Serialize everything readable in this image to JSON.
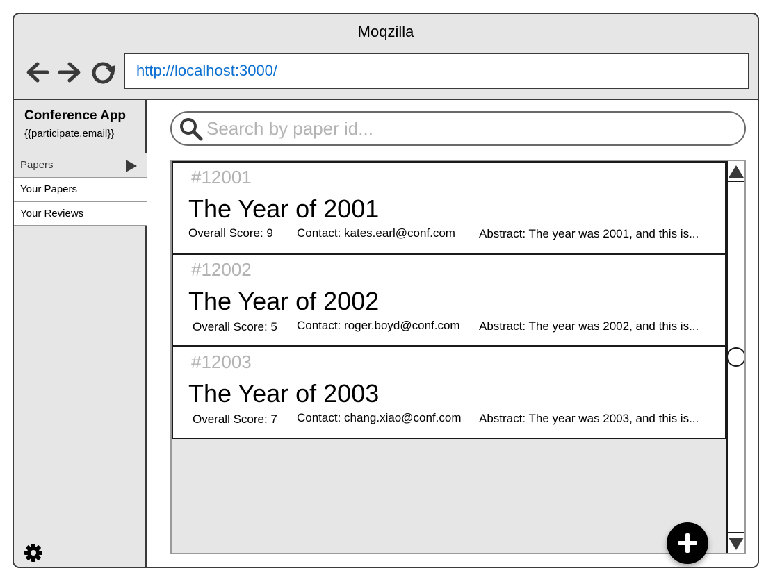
{
  "window": {
    "title": "Moqzilla"
  },
  "navbar": {
    "back_icon": "arrow-left-icon",
    "forward_icon": "arrow-right-icon",
    "reload_icon": "reload-icon",
    "url": "http://localhost:3000/"
  },
  "sidebar": {
    "app_title": "Conference App",
    "app_subtitle": "{{participate.email}}",
    "menu_header": "Papers",
    "items": [
      {
        "label": "Your Papers"
      },
      {
        "label": "Your Reviews"
      }
    ],
    "settings_icon": "gear-icon"
  },
  "search": {
    "icon": "search-icon",
    "placeholder": "Search by paper id..."
  },
  "papers": [
    {
      "id": "#12001",
      "title": "The Year of 2001",
      "score": "Overall Score: 9",
      "contact": "Contact: kates.earl@conf.com",
      "abstract": "Abstract: The year was 2001, and this is..."
    },
    {
      "id": "#12002",
      "title": "The Year of 2002",
      "score": "Overall Score: 5",
      "contact": "Contact: roger.boyd@conf.com",
      "abstract": "Abstract: The year was 2002, and this is..."
    },
    {
      "id": "#12003",
      "title": "The Year of 2003",
      "score": "Overall Score: 7",
      "contact": "Contact: chang.xiao@conf.com",
      "abstract": "Abstract: The year was 2003, and this is..."
    }
  ],
  "scrollbar": {
    "position_fraction": 0.5
  },
  "fab": {
    "icon": "plus-icon"
  },
  "colors": {
    "url_text": "#0b6fd1",
    "chrome_background": "#e6e6e6",
    "placeholder_text": "#b3b3b3",
    "fab_background": "#000000"
  }
}
